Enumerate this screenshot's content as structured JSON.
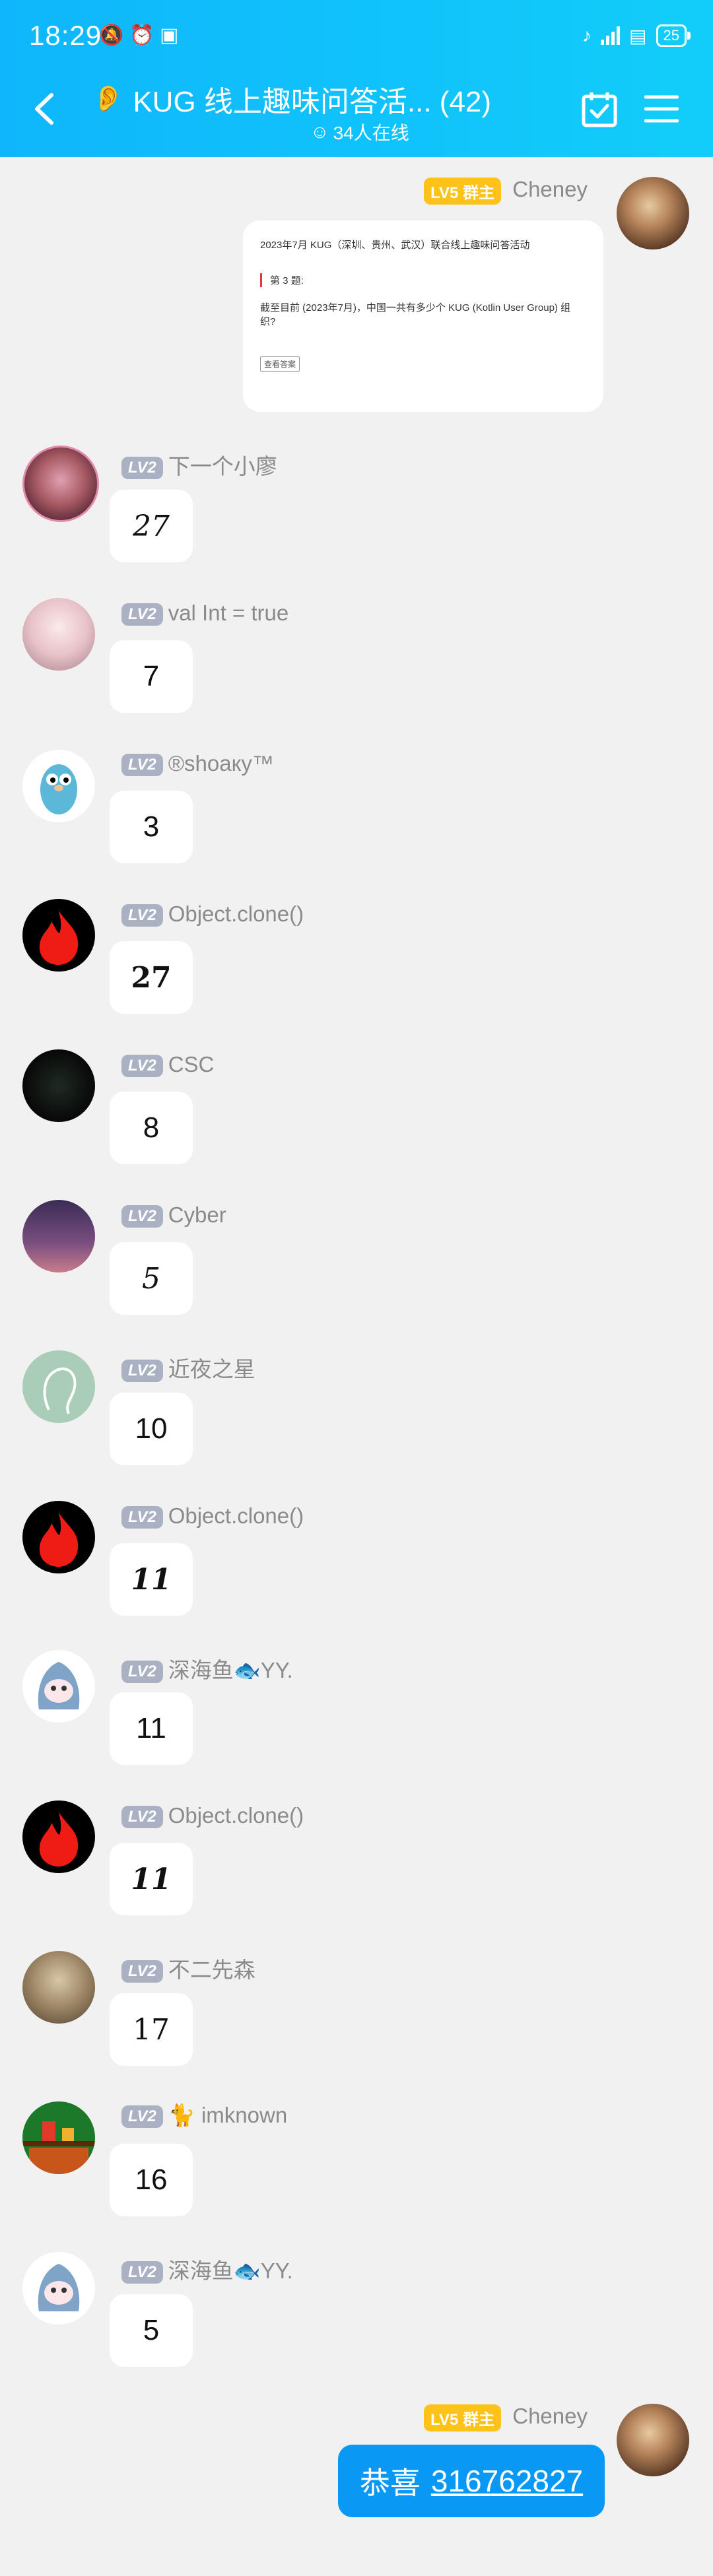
{
  "status_bar": {
    "time": "18:29",
    "battery": "25"
  },
  "header": {
    "title": "KUG 线上趣味问答活... (42)",
    "online": "34人在线"
  },
  "owner_badge": "LV5 群主",
  "member_badge": "LV2",
  "messages": [
    {
      "nick": "Cheney",
      "type": "card"
    },
    {
      "nick": "下一个小廖",
      "text": "27"
    },
    {
      "nick": "val Int  = true",
      "text": "7"
    },
    {
      "nick": "®shoaку™",
      "text": "3"
    },
    {
      "nick": "Object.clone()",
      "text": "27"
    },
    {
      "nick": "CSC",
      "text": "8"
    },
    {
      "nick": "Cyber",
      "text": "5"
    },
    {
      "nick": "近夜之星",
      "text": "10"
    },
    {
      "nick": "Object.clone()",
      "text": "11"
    },
    {
      "nick": "深海鱼🐟YY.",
      "text": "11"
    },
    {
      "nick": "Object.clone()",
      "text": "11"
    },
    {
      "nick": "不二先森",
      "text": "17"
    },
    {
      "nick": "🐈 imknown",
      "text": "16"
    },
    {
      "nick": "深海鱼🐟YY.",
      "text": "5"
    },
    {
      "nick": "Cheney",
      "text": "恭喜",
      "link": "316762827"
    }
  ],
  "card": {
    "title": "2023年7月 KUG（深圳、贵州、武汉）联合线上趣味问答活动",
    "question_no": "第 3 题:",
    "question": "截至目前 (2023年7月)，中国一共有多少个 KUG (Kotlin User Group) 组织?",
    "button": "查看答案"
  },
  "colors": {
    "header": "#10c3fb",
    "owner_badge": "#ffc21a",
    "member_badge": "#aab1c3",
    "send_bubble": "#0a98f5"
  }
}
